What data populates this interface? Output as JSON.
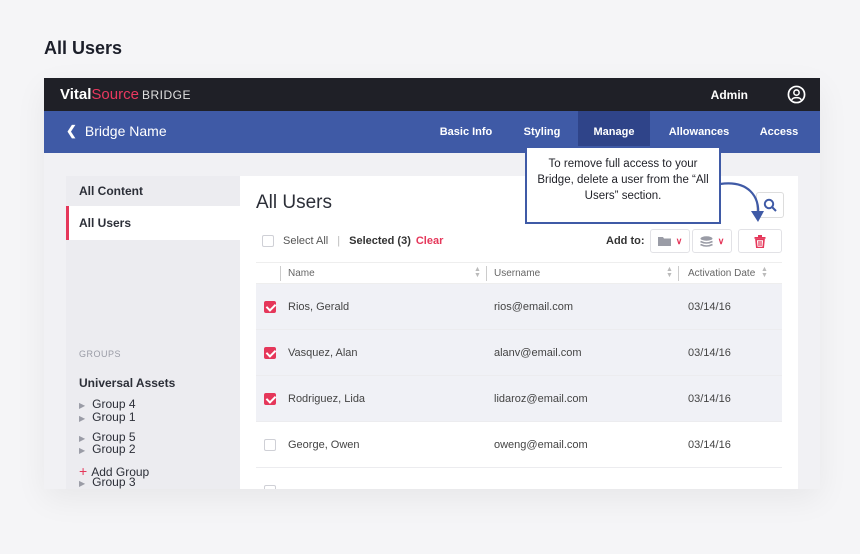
{
  "page_heading": "All Users",
  "topbar": {
    "logo_vital": "Vital",
    "logo_source": "Source",
    "logo_bridge": "BRIDGE",
    "admin_label": "Admin",
    "user_icon": "user-circle-icon"
  },
  "navbar": {
    "back_label": "Bridge Name",
    "tabs": [
      {
        "label": "Basic Info",
        "active": false
      },
      {
        "label": "Styling",
        "active": false
      },
      {
        "label": "Manage",
        "active": true
      },
      {
        "label": "Allowances",
        "active": false
      },
      {
        "label": "Access",
        "active": false
      }
    ]
  },
  "sidebar": {
    "all_content": "All Content",
    "all_users": "All Users",
    "groups_label": "GROUPS",
    "universal_assets": "Universal Assets",
    "groups": [
      "Group 1",
      "Group 2",
      "Group 3",
      "Group 4",
      "Group 5"
    ],
    "add_group": "Add Group"
  },
  "main": {
    "title": "All Users",
    "select_all": "Select All",
    "selected_count": "Selected (3)",
    "clear": "Clear",
    "add_to": "Add to:",
    "columns": [
      "Name",
      "Username",
      "Activation Date"
    ],
    "rows": [
      {
        "name": "Rios, Gerald",
        "username": "rios@email.com",
        "date": "03/14/16",
        "checked": true
      },
      {
        "name": "Vasquez, Alan",
        "username": "alanv@email.com",
        "date": "03/14/16",
        "checked": true
      },
      {
        "name": "Rodriguez, Lida",
        "username": "lidaroz@email.com",
        "date": "03/14/16",
        "checked": true
      },
      {
        "name": "George, Owen",
        "username": "oweng@email.com",
        "date": "03/14/16",
        "checked": false
      }
    ]
  },
  "tooltip": {
    "text": "To remove full access to your Bridge, delete a user from the “All Users” section."
  },
  "colors": {
    "accent": "#e5375a",
    "nav": "#3f5aa6",
    "nav_active": "#2f4489",
    "topbar": "#1f2027"
  }
}
